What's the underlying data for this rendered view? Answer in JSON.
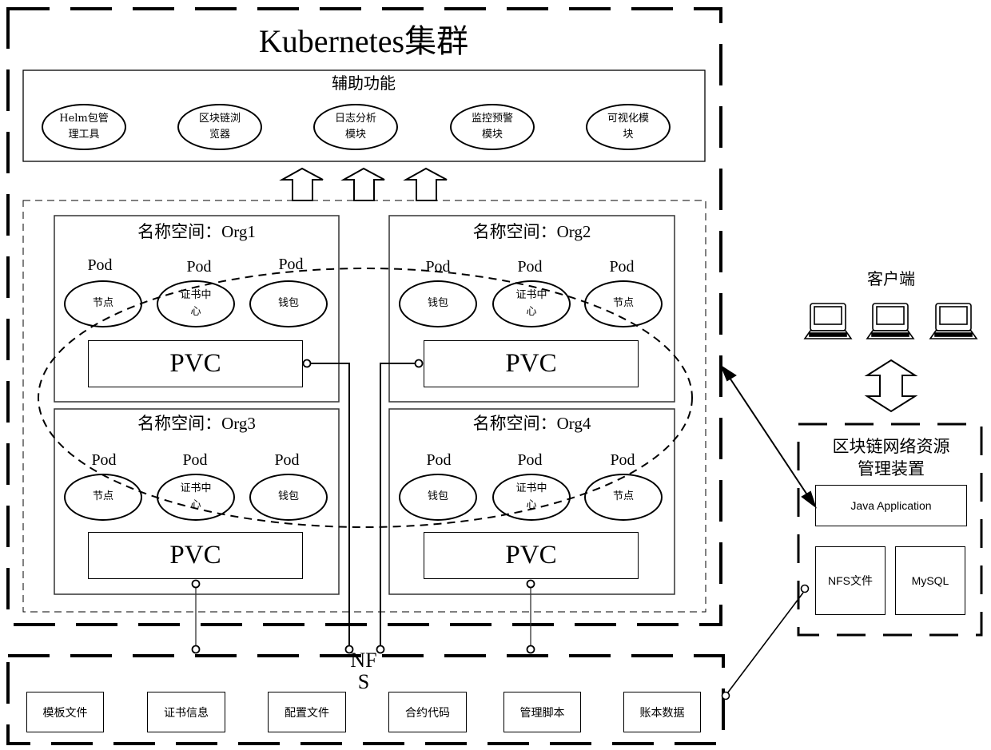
{
  "cluster": {
    "title": "Kubernetes集群",
    "aux": {
      "title": "辅助功能",
      "modules": [
        {
          "line1": "Helm包管",
          "line2": "理工具"
        },
        {
          "line1": "区块链浏",
          "line2": "览器"
        },
        {
          "line1": "日志分析",
          "line2": "模块"
        },
        {
          "line1": "监控预警",
          "line2": "模块"
        },
        {
          "line1": "可视化模",
          "line2": "块"
        }
      ]
    },
    "namespaces": [
      {
        "title": "名称空间：Org1",
        "pods": [
          {
            "label": "Pod",
            "name": "节点",
            "name2": ""
          },
          {
            "label": "Pod",
            "name": "证书中",
            "name2": "心"
          },
          {
            "label": "Pod",
            "name": "钱包",
            "name2": ""
          }
        ],
        "pvc": "PVC"
      },
      {
        "title": "名称空间：Org2",
        "pods": [
          {
            "label": "Pod",
            "name": "钱包",
            "name2": ""
          },
          {
            "label": "Pod",
            "name": "证书中",
            "name2": "心"
          },
          {
            "label": "Pod",
            "name": "节点",
            "name2": ""
          }
        ],
        "pvc": "PVC"
      },
      {
        "title": "名称空间：Org3",
        "pods": [
          {
            "label": "Pod",
            "name": "节点",
            "name2": ""
          },
          {
            "label": "Pod",
            "name": "证书中",
            "name2": "心"
          },
          {
            "label": "Pod",
            "name": "钱包",
            "name2": ""
          }
        ],
        "pvc": "PVC"
      },
      {
        "title": "名称空间：Org4",
        "pods": [
          {
            "label": "Pod",
            "name": "钱包",
            "name2": ""
          },
          {
            "label": "Pod",
            "name": "证书中",
            "name2": "心"
          },
          {
            "label": "Pod",
            "name": "节点",
            "name2": ""
          }
        ],
        "pvc": "PVC"
      }
    ]
  },
  "nfs": {
    "label_line1": "NF",
    "label_line2": "S",
    "files": [
      "模板文件",
      "证书信息",
      "配置文件",
      "合约代码",
      "管理脚本",
      "账本数据"
    ]
  },
  "client": {
    "title": "客户端",
    "devices": [
      "laptop",
      "laptop",
      "laptop"
    ]
  },
  "manager": {
    "title_line1": "区块链网络资源",
    "title_line2": "管理装置",
    "java_app": "Java Application",
    "nfs_files": "NFS文件",
    "mysql": "MySQL"
  }
}
